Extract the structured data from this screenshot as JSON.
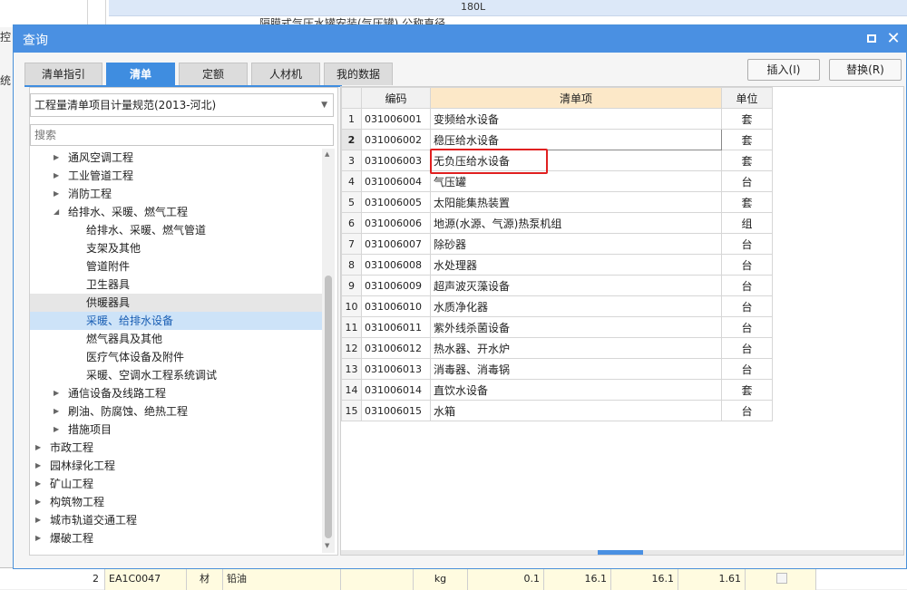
{
  "background": {
    "top_cell_1": "180L",
    "top_cell_2": "隔膜式气压水罐安装(气压罐) 公称直径",
    "left_labels": [
      "控",
      "统"
    ],
    "bottom_row": {
      "num": "2",
      "code": "EA1C0047",
      "type": "材",
      "name": "铅油",
      "unit": "kg",
      "v1": "0.1",
      "v2": "16.1",
      "v3": "16.1",
      "v4": "1.61"
    }
  },
  "dialog": {
    "title": "查询",
    "tabs": [
      {
        "label": "清单指引",
        "active": false
      },
      {
        "label": "清单",
        "active": true
      },
      {
        "label": "定额",
        "active": false
      },
      {
        "label": "人材机",
        "active": false
      },
      {
        "label": "我的数据",
        "active": false
      }
    ],
    "insert_button": "插入(I)",
    "replace_button": "替换(R)",
    "spec_select": "工程量清单项目计量规范(2013-河北)",
    "search_placeholder": "搜索",
    "tree": [
      {
        "label": "通风空调工程",
        "level": 1,
        "arrow": "right"
      },
      {
        "label": "工业管道工程",
        "level": 1,
        "arrow": "right"
      },
      {
        "label": "消防工程",
        "level": 1,
        "arrow": "right"
      },
      {
        "label": "给排水、采暖、燃气工程",
        "level": 1,
        "arrow": "down"
      },
      {
        "label": "给排水、采暖、燃气管道",
        "level": 2
      },
      {
        "label": "支架及其他",
        "level": 2
      },
      {
        "label": "管道附件",
        "level": 2
      },
      {
        "label": "卫生器具",
        "level": 2
      },
      {
        "label": "供暖器具",
        "level": 2,
        "state": "hover"
      },
      {
        "label": "采暖、给排水设备",
        "level": 2,
        "state": "selected"
      },
      {
        "label": "燃气器具及其他",
        "level": 2
      },
      {
        "label": "医疗气体设备及附件",
        "level": 2
      },
      {
        "label": "采暖、空调水工程系统调试",
        "level": 2
      },
      {
        "label": "通信设备及线路工程",
        "level": 1,
        "arrow": "right"
      },
      {
        "label": "刷油、防腐蚀、绝热工程",
        "level": 1,
        "arrow": "right"
      },
      {
        "label": "措施项目",
        "level": 1,
        "arrow": "right"
      },
      {
        "label": "市政工程",
        "level": 0,
        "arrow": "right"
      },
      {
        "label": "园林绿化工程",
        "level": 0,
        "arrow": "right"
      },
      {
        "label": "矿山工程",
        "level": 0,
        "arrow": "right"
      },
      {
        "label": "构筑物工程",
        "level": 0,
        "arrow": "right"
      },
      {
        "label": "城市轨道交通工程",
        "level": 0,
        "arrow": "right"
      },
      {
        "label": "爆破工程",
        "level": 0,
        "arrow": "right"
      }
    ],
    "grid": {
      "headers": {
        "code": "编码",
        "name": "清单项",
        "unit": "单位"
      },
      "rows": [
        {
          "n": "1",
          "code": "031006001",
          "name": "变频给水设备",
          "unit": "套"
        },
        {
          "n": "2",
          "code": "031006002",
          "name": "稳压给水设备",
          "unit": "套"
        },
        {
          "n": "3",
          "code": "031006003",
          "name": "无负压给水设备",
          "unit": "套"
        },
        {
          "n": "4",
          "code": "031006004",
          "name": "气压罐",
          "unit": "台"
        },
        {
          "n": "5",
          "code": "031006005",
          "name": "太阳能集热装置",
          "unit": "套"
        },
        {
          "n": "6",
          "code": "031006006",
          "name": "地源(水源、气源)热泵机组",
          "unit": "组"
        },
        {
          "n": "7",
          "code": "031006007",
          "name": "除砂器",
          "unit": "台"
        },
        {
          "n": "8",
          "code": "031006008",
          "name": "水处理器",
          "unit": "台"
        },
        {
          "n": "9",
          "code": "031006009",
          "name": "超声波灭藻设备",
          "unit": "台"
        },
        {
          "n": "10",
          "code": "031006010",
          "name": "水质净化器",
          "unit": "台"
        },
        {
          "n": "11",
          "code": "031006011",
          "name": "紫外线杀菌设备",
          "unit": "台"
        },
        {
          "n": "12",
          "code": "031006012",
          "name": "热水器、开水炉",
          "unit": "台"
        },
        {
          "n": "13",
          "code": "031006013",
          "name": "消毒器、消毒锅",
          "unit": "台"
        },
        {
          "n": "14",
          "code": "031006014",
          "name": "直饮水设备",
          "unit": "套"
        },
        {
          "n": "15",
          "code": "031006015",
          "name": "水箱",
          "unit": "台"
        }
      ],
      "selected_row": 2
    }
  }
}
